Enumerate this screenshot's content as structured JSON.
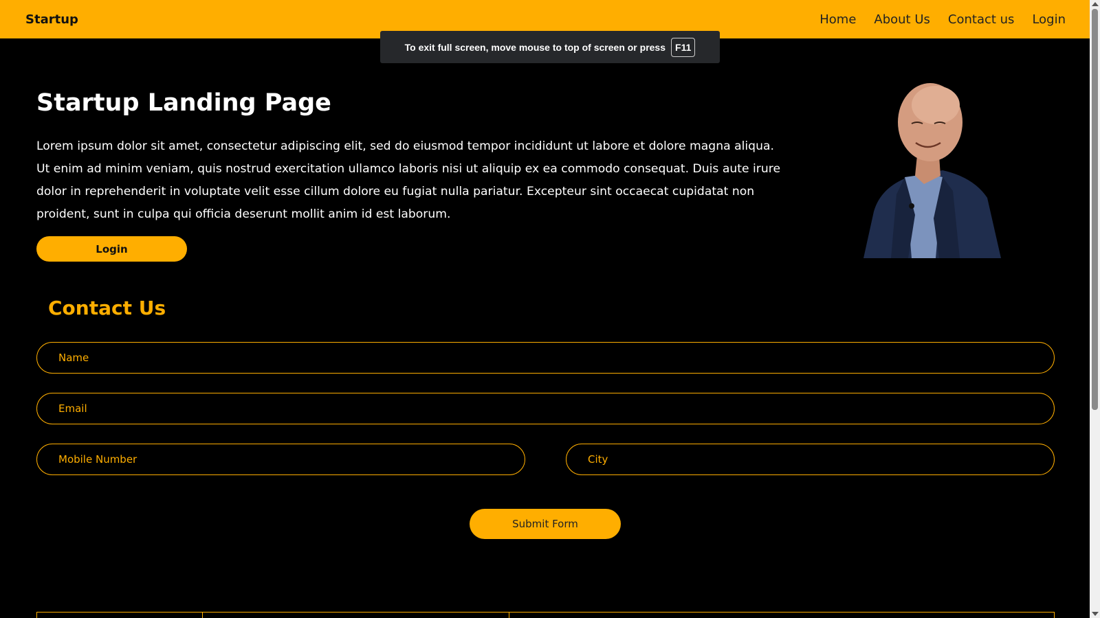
{
  "navbar": {
    "brand": "Startup",
    "links": [
      "Home",
      "About Us",
      "Contact us",
      "Login"
    ]
  },
  "fullscreen_notice": {
    "text": "To exit full screen, move mouse to top of screen or press",
    "key": "F11"
  },
  "hero": {
    "title": "Startup Landing Page",
    "paragraph": "Lorem ipsum dolor sit amet, consectetur adipiscing elit, sed do eiusmod tempor incididunt ut labore et dolore magna aliqua. Ut enim ad minim veniam, quis nostrud exercitation ullamco laboris nisi ut aliquip ex ea commodo consequat. Duis aute irure dolor in reprehenderit in voluptate velit esse cillum dolore eu fugiat nulla pariatur. Excepteur sint occaecat cupidatat non proident, sunt in culpa qui officia deserunt mollit anim id est laborum.",
    "button_label": "Login"
  },
  "contact": {
    "title": "Contact Us",
    "name_placeholder": "Name",
    "email_placeholder": "Email",
    "mobile_placeholder": "Mobile Number",
    "city_placeholder": "City",
    "submit_label": "Submit Form"
  },
  "colors": {
    "accent": "#ffae00",
    "background": "#000000",
    "toast": "#26282b"
  }
}
